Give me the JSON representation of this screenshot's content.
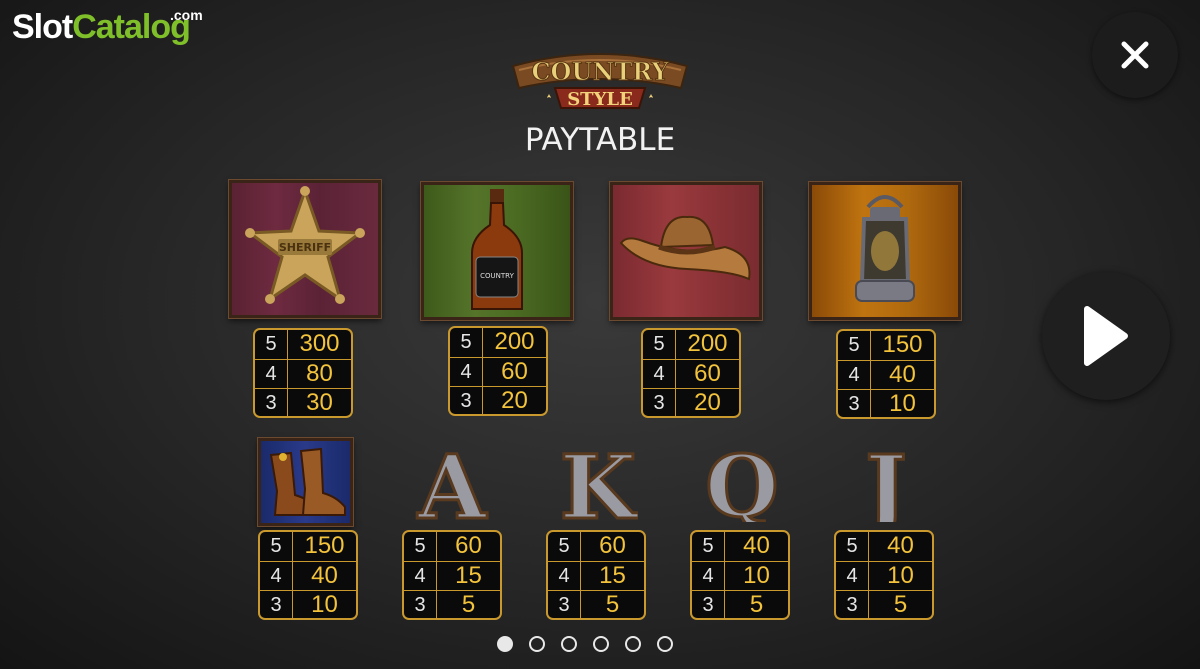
{
  "brand": {
    "slot": "Slot",
    "catalog": "Catalog",
    "com": ".com"
  },
  "game": {
    "logo_line1": "COUNTRY",
    "logo_line2": "STYLE",
    "title": "PAYTABLE"
  },
  "controls": {
    "close_icon": "close-icon",
    "next_icon": "play-arrow-icon"
  },
  "counts": [
    "5",
    "4",
    "3"
  ],
  "symbols": [
    {
      "name": "sheriff-badge",
      "icon": "sheriff-star-icon",
      "badge_text": "SHERIFF",
      "pays": [
        "300",
        "80",
        "30"
      ]
    },
    {
      "name": "whiskey-bottle",
      "icon": "bottle-icon",
      "label_text": "COUNTRY",
      "pays": [
        "200",
        "60",
        "20"
      ]
    },
    {
      "name": "cowboy-hat",
      "icon": "hat-icon",
      "pays": [
        "200",
        "60",
        "20"
      ]
    },
    {
      "name": "lantern",
      "icon": "lantern-icon",
      "pays": [
        "150",
        "40",
        "10"
      ]
    },
    {
      "name": "cowboy-boots",
      "icon": "boots-icon",
      "pays": [
        "150",
        "40",
        "10"
      ]
    },
    {
      "name": "letter-a",
      "letter": "A",
      "pays": [
        "60",
        "15",
        "5"
      ]
    },
    {
      "name": "letter-k",
      "letter": "K",
      "pays": [
        "60",
        "15",
        "5"
      ]
    },
    {
      "name": "letter-q",
      "letter": "Q",
      "pays": [
        "40",
        "10",
        "5"
      ]
    },
    {
      "name": "letter-j",
      "letter": "J",
      "pays": [
        "40",
        "10",
        "5"
      ]
    }
  ],
  "pagination": {
    "total_pages": 6,
    "current_page": 1
  },
  "colors": {
    "accent_gold": "#c9992e",
    "value_gold": "#f3c33c",
    "brand_green": "#7fbf2a"
  }
}
